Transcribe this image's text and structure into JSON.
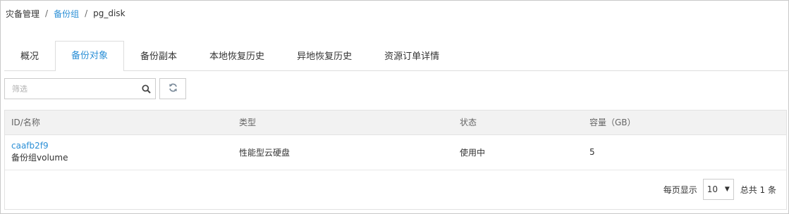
{
  "breadcrumb": {
    "items": [
      "灾备管理",
      "备份组",
      "pg_disk"
    ]
  },
  "tabs": [
    {
      "label": "概况"
    },
    {
      "label": "备份对象"
    },
    {
      "label": "备份副本"
    },
    {
      "label": "本地恢复历史"
    },
    {
      "label": "异地恢复历史"
    },
    {
      "label": "资源订单详情"
    }
  ],
  "toolbar": {
    "search_placeholder": "筛选",
    "search_icon": "search-icon",
    "refresh_icon": "refresh-icon"
  },
  "table": {
    "headers": [
      "ID/名称",
      "类型",
      "状态",
      "容量（GB）"
    ],
    "rows": [
      {
        "id": "caafb2f9",
        "name": "备份组volume",
        "type": "性能型云硬盘",
        "status": "使用中",
        "capacity": "5"
      }
    ]
  },
  "pager": {
    "per_page_label": "每页显示",
    "per_page_value": "10",
    "total_label": "总共 1 条"
  },
  "colors": {
    "accent": "#2b8fd6",
    "border": "#cccccc",
    "header_bg": "#f2f2f2"
  }
}
